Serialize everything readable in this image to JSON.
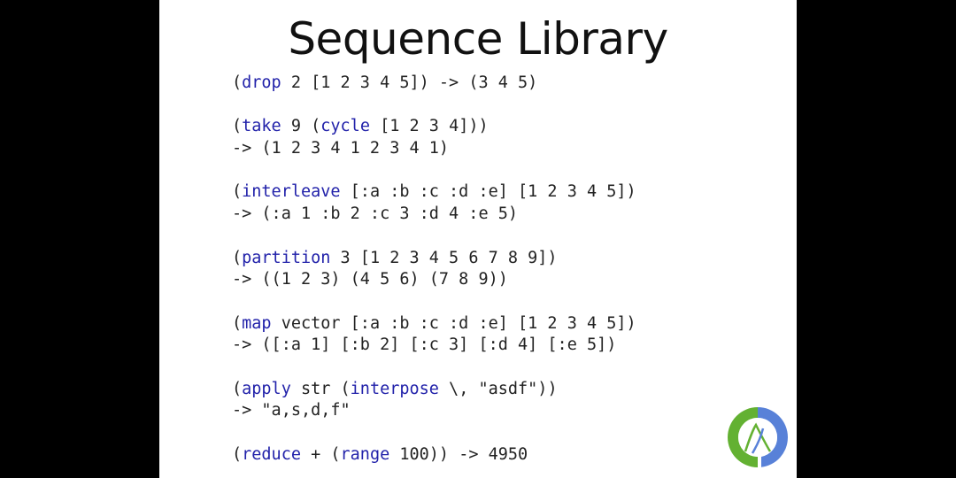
{
  "slide": {
    "title": "Sequence Library",
    "keyword_color": "#2222aa",
    "text_color": "#222222",
    "logo_icon": "clojure-logo-icon",
    "examples": [
      {
        "lines": [
          [
            {
              "t": "("
            },
            {
              "t": "drop",
              "kw": true
            },
            {
              "t": " 2 [1 2 3 4 5]) -> (3 4 5)"
            }
          ]
        ]
      },
      {
        "lines": [
          [
            {
              "t": "("
            },
            {
              "t": "take",
              "kw": true
            },
            {
              "t": " 9 ("
            },
            {
              "t": "cycle",
              "kw": true
            },
            {
              "t": " [1 2 3 4]))"
            }
          ],
          [
            {
              "t": "-> (1 2 3 4 1 2 3 4 1)"
            }
          ]
        ]
      },
      {
        "lines": [
          [
            {
              "t": "("
            },
            {
              "t": "interleave",
              "kw": true
            },
            {
              "t": " [:a :b :c :d :e] [1 2 3 4 5])"
            }
          ],
          [
            {
              "t": "-> (:a 1 :b 2 :c 3 :d 4 :e 5)"
            }
          ]
        ]
      },
      {
        "lines": [
          [
            {
              "t": "("
            },
            {
              "t": "partition",
              "kw": true
            },
            {
              "t": " 3 [1 2 3 4 5 6 7 8 9])"
            }
          ],
          [
            {
              "t": "-> ((1 2 3) (4 5 6) (7 8 9))"
            }
          ]
        ]
      },
      {
        "lines": [
          [
            {
              "t": "("
            },
            {
              "t": "map",
              "kw": true
            },
            {
              "t": " vector [:a :b :c :d :e] [1 2 3 4 5])"
            }
          ],
          [
            {
              "t": "-> ([:a 1] [:b 2] [:c 3] [:d 4] [:e 5])"
            }
          ]
        ]
      },
      {
        "lines": [
          [
            {
              "t": "("
            },
            {
              "t": "apply",
              "kw": true
            },
            {
              "t": " str ("
            },
            {
              "t": "interpose",
              "kw": true
            },
            {
              "t": " \\, \"asdf\"))"
            }
          ],
          [
            {
              "t": "-> \"a,s,d,f\""
            }
          ]
        ]
      },
      {
        "lines": [
          [
            {
              "t": "("
            },
            {
              "t": "reduce",
              "kw": true
            },
            {
              "t": " + ("
            },
            {
              "t": "range",
              "kw": true
            },
            {
              "t": " 100)) -> 4950"
            }
          ]
        ]
      }
    ]
  }
}
